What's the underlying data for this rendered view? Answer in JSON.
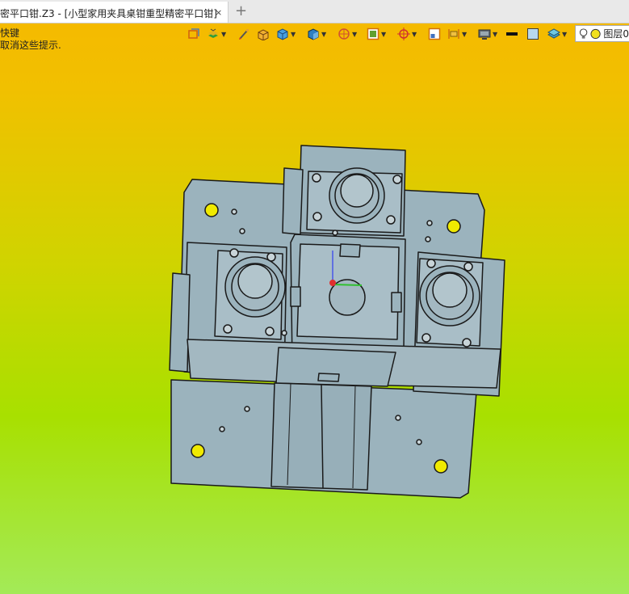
{
  "tab": {
    "title": "密平口钳.Z3 - [小型家用夹具桌钳重型精密平口钳]",
    "close": "×",
    "add": "+"
  },
  "hint": {
    "line1": "快键",
    "line2": "取消这些提示."
  },
  "toolbar": {
    "items": [
      {
        "icon": "cube-frame-icon"
      },
      {
        "icon": "layers-stack-icon"
      },
      {
        "icon": "brush-icon"
      },
      {
        "icon": "shaded-box-icon"
      },
      {
        "icon": "blue-cube-icon"
      },
      {
        "icon": "view-cube-icon"
      },
      {
        "icon": "rotate-view-icon"
      },
      {
        "icon": "zoom-fit-icon"
      },
      {
        "icon": "target-icon"
      },
      {
        "icon": "grid-icon"
      },
      {
        "icon": "align-icon"
      },
      {
        "icon": "monitor-icon"
      },
      {
        "icon": "line-weight-icon"
      },
      {
        "icon": "color-swatch-icon"
      },
      {
        "icon": "layer-icon"
      }
    ],
    "layer_label": "图层0"
  },
  "colors": {
    "model_fill": "#9bb3bd",
    "model_stroke": "#1a1a1a",
    "hole_yellow": "#f0ea00"
  }
}
